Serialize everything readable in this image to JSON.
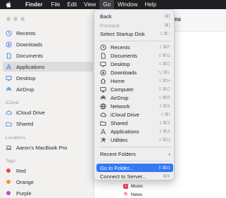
{
  "menubar": {
    "app_name": "Finder",
    "items": [
      "File",
      "Edit",
      "View",
      "Go",
      "Window",
      "Help"
    ]
  },
  "sidebar": {
    "favorites": [
      "Recents",
      "Downloads",
      "Documents",
      "Applications",
      "Desktop",
      "AirDrop"
    ],
    "icloud_header": "iCloud",
    "icloud": [
      "iCloud Drive",
      "Shared"
    ],
    "locations_header": "Locations",
    "locations": [
      "Aaron's MacBook Pro"
    ],
    "tags_header": "Tags",
    "tags": [
      {
        "label": "Red",
        "color": "#e8473c"
      },
      {
        "label": "Orange",
        "color": "#f29a2e"
      },
      {
        "label": "Purple",
        "color": "#a956c9"
      }
    ]
  },
  "main": {
    "title_fragment": "tions",
    "files": [
      {
        "label": "Music",
        "icon": "music-app-icon",
        "color": "#f0455d"
      },
      {
        "label": "News",
        "icon": "news-app-icon",
        "color": "#f0384e"
      }
    ]
  },
  "go_menu": {
    "back": {
      "label": "Back",
      "shortcut": "⌘["
    },
    "forward": {
      "label": "Forward",
      "shortcut": "⌘]"
    },
    "startup": {
      "label": "Select Startup Disk",
      "shortcut": "⇧⌘↑"
    },
    "places": [
      {
        "label": "Recents",
        "shortcut": "⇧⌘F",
        "icon": "clock-icon"
      },
      {
        "label": "Documents",
        "shortcut": "⇧⌘O",
        "icon": "document-icon"
      },
      {
        "label": "Desktop",
        "shortcut": "⇧⌘D",
        "icon": "desktop-icon"
      },
      {
        "label": "Downloads",
        "shortcut": "⌥⌘L",
        "icon": "download-icon"
      },
      {
        "label": "Home",
        "shortcut": "⇧⌘H",
        "icon": "home-icon"
      },
      {
        "label": "Computer",
        "shortcut": "⇧⌘C",
        "icon": "computer-icon"
      },
      {
        "label": "AirDrop",
        "shortcut": "⇧⌘R",
        "icon": "airdrop-icon"
      },
      {
        "label": "Network",
        "shortcut": "⇧⌘K",
        "icon": "globe-icon"
      },
      {
        "label": "iCloud Drive",
        "shortcut": "⇧⌘I",
        "icon": "cloud-icon"
      },
      {
        "label": "Shared",
        "shortcut": "⇧⌘S",
        "icon": "shared-folder-icon"
      },
      {
        "label": "Applications",
        "shortcut": "⇧⌘A",
        "icon": "applications-icon"
      },
      {
        "label": "Utilities",
        "shortcut": "⇧⌘U",
        "icon": "utilities-icon"
      }
    ],
    "recent_folders": "Recent Folders",
    "go_to_folder": {
      "label": "Go to Folder...",
      "shortcut": "⇧⌘G"
    },
    "connect": {
      "label": "Connect to Server...",
      "shortcut": "⌘K"
    }
  },
  "colors": {
    "accent": "#3478f6",
    "sidebar_icon": "#3a82f7",
    "menubar_bg": "#1e1f22"
  }
}
